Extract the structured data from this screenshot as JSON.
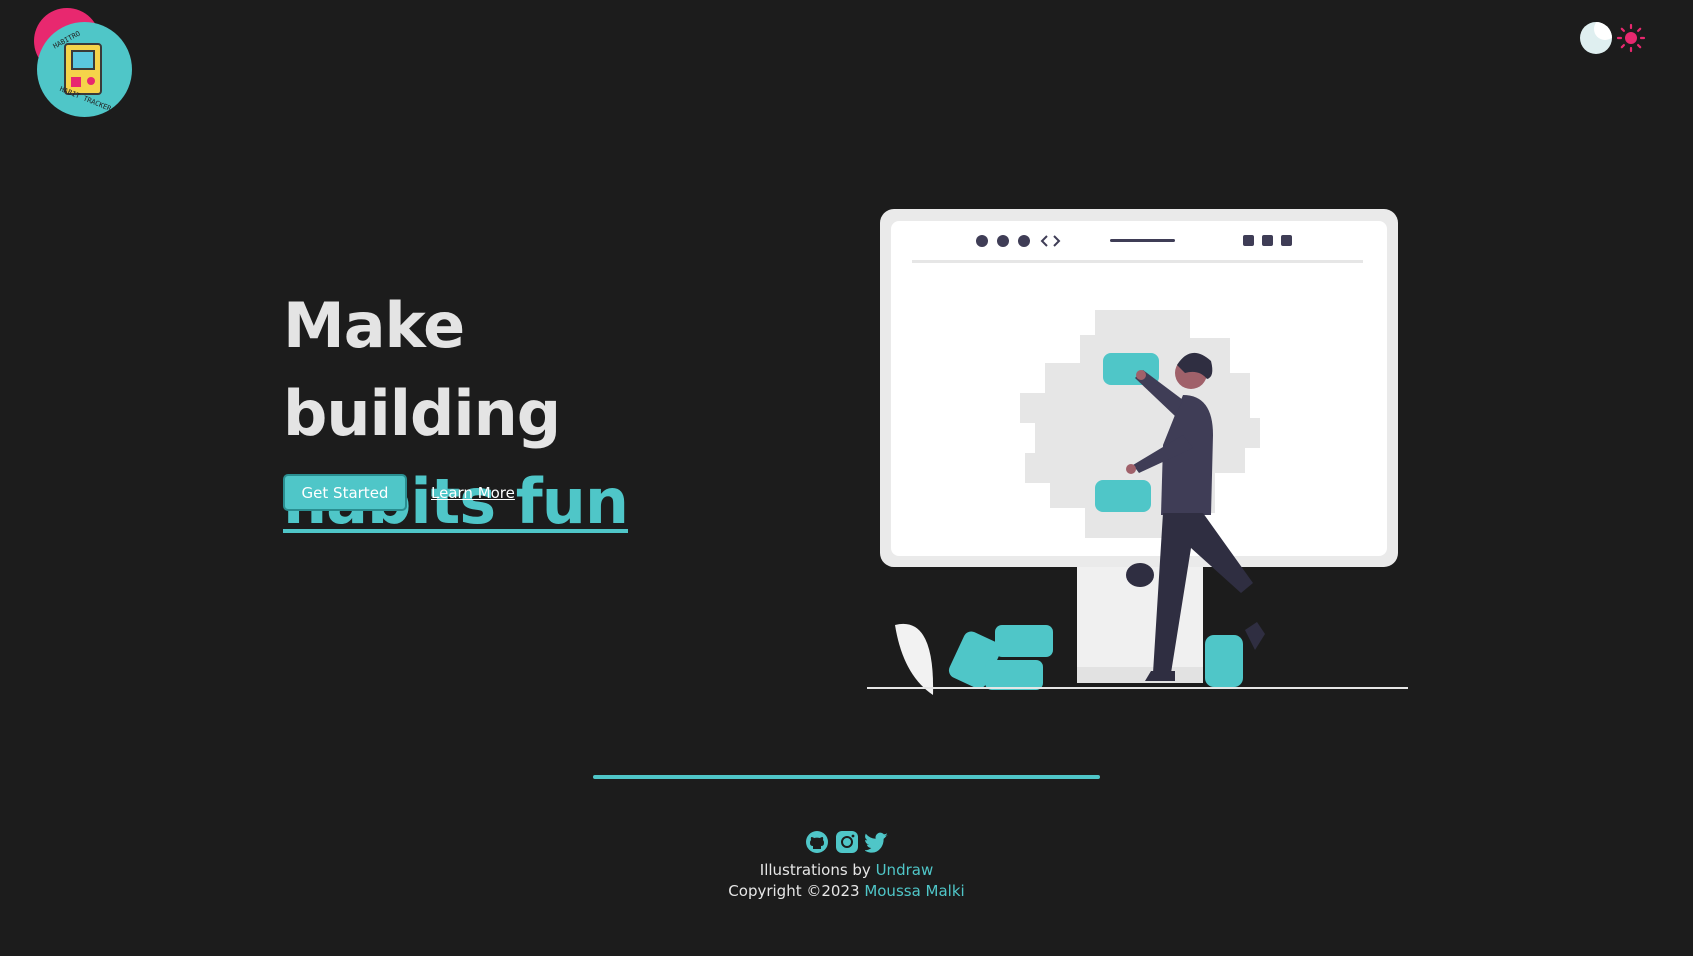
{
  "logo": {
    "top_text": "HABITRO",
    "bottom_text": "HABIT TRACKER"
  },
  "theme_toggle": {
    "dark_icon": "moon-icon",
    "light_icon": "sun-icon",
    "sun_color": "#e8286f"
  },
  "hero": {
    "title_line1": "Make building",
    "title_line2": "habits fun",
    "primary_button": "Get Started",
    "secondary_link": "Learn More"
  },
  "footer": {
    "social_icons": [
      "github-icon",
      "instagram-icon",
      "twitter-icon"
    ],
    "credit_prefix": "Illustrations by ",
    "credit_link": "Undraw",
    "copyright_prefix": "Copyright ©2023 ",
    "author_link": "Moussa Malki"
  },
  "colors": {
    "background": "#1c1c1c",
    "accent": "#4fc6c8",
    "brand_pink": "#e8286f",
    "text": "#e6e6e6"
  }
}
